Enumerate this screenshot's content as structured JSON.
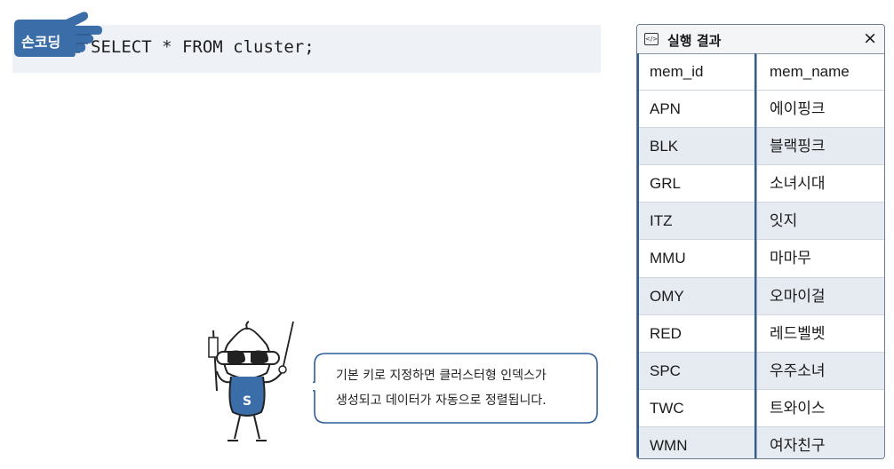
{
  "code_box": {
    "badge_label": "손코딩",
    "code": "SELECT * FROM cluster;",
    "badge_color": "#3b6ea8"
  },
  "callout": {
    "line1": "기본 키로 지정하면 클러스터형 인덱스가",
    "line2": "생성되고 데이터가 자동으로 정렬됩니다.",
    "border_color": "#2d5d9a"
  },
  "result_panel": {
    "title": "실행 결과",
    "close_glyph": "×",
    "columns": [
      "mem_id",
      "mem_name"
    ],
    "rows": [
      [
        "APN",
        "에이핑크"
      ],
      [
        "BLK",
        "블랙핑크"
      ],
      [
        "GRL",
        "소녀시대"
      ],
      [
        "ITZ",
        "잇지"
      ],
      [
        "MMU",
        "마마무"
      ],
      [
        "OMY",
        "오마이걸"
      ],
      [
        "RED",
        "레드벨벳"
      ],
      [
        "SPC",
        "우주소녀"
      ],
      [
        "TWC",
        "트와이스"
      ],
      [
        "WMN",
        "여자친구"
      ]
    ],
    "highlight_color": "#2d5d9a",
    "shaded_row_color": "#e6ebf1"
  },
  "icons": {
    "hand": "pointing-hand-icon",
    "result": "code-window-icon",
    "close": "close-icon",
    "mascot": "mascot-icon"
  }
}
